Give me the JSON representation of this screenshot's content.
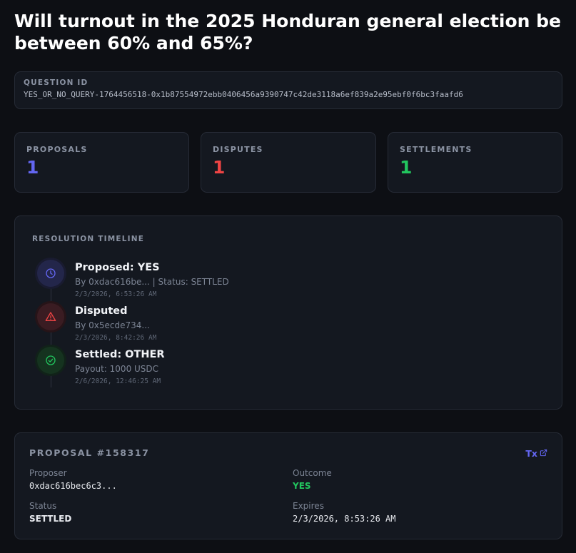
{
  "title": "Will turnout in the 2025 Honduran general election be between 60% and 65%?",
  "question": {
    "label": "QUESTION ID",
    "value": "YES_OR_NO_QUERY-1764456518-0x1b87554972ebb0406456a9390747c42de3118a6ef839a2e95ebf0f6bc3faafd6"
  },
  "stats": [
    {
      "label": "PROPOSALS",
      "value": "1",
      "color": "#6366f1"
    },
    {
      "label": "DISPUTES",
      "value": "1",
      "color": "#ef4444"
    },
    {
      "label": "SETTLEMENTS",
      "value": "1",
      "color": "#22c55e"
    }
  ],
  "timeline": {
    "title": "RESOLUTION TIMELINE",
    "items": [
      {
        "icon": "clock-icon",
        "title": "Proposed: YES",
        "sub": "By 0xdac616be... | Status: SETTLED",
        "time": "2/3/2026, 6:53:26 AM",
        "color": "#6366f1"
      },
      {
        "icon": "alert-triangle-icon",
        "title": "Disputed",
        "sub": "By 0x5ecde734...",
        "time": "2/3/2026, 8:42:26 AM",
        "color": "#ef4444"
      },
      {
        "icon": "check-circle-icon",
        "title": "Settled: OTHER",
        "sub": "Payout: 1000 USDC",
        "time": "2/6/2026, 12:46:25 AM",
        "color": "#22c55e"
      }
    ]
  },
  "proposal": {
    "title": "PROPOSAL #158317",
    "tx_label": "Tx",
    "proposer_label": "Proposer",
    "proposer": "0xdac616bec6c3...",
    "outcome_label": "Outcome",
    "outcome": "YES",
    "status_label": "Status",
    "status": "SETTLED",
    "expires_label": "Expires",
    "expires": "2/3/2026, 8:53:26 AM"
  }
}
